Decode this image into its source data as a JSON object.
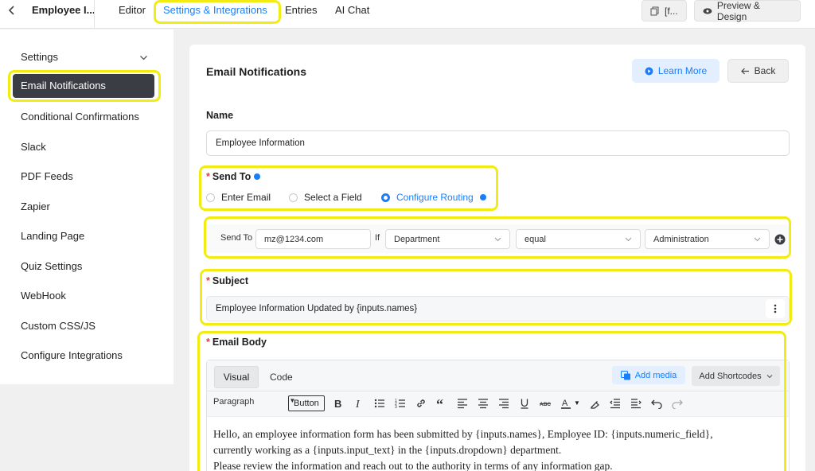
{
  "topbar": {
    "form_name": "Employee I...",
    "tabs": [
      "Editor",
      "Settings & Integrations",
      "Entries",
      "AI Chat"
    ],
    "shortcode_btn": "[f...",
    "preview_btn": "Preview & Design"
  },
  "sidebar": {
    "items": [
      "Settings",
      "Email Notifications",
      "Conditional Confirmations",
      "Slack",
      "PDF Feeds",
      "Zapier",
      "Landing Page",
      "Quiz Settings",
      "WebHook",
      "Custom CSS/JS",
      "Configure Integrations"
    ]
  },
  "card": {
    "title": "Email Notifications",
    "learn_more": "Learn More",
    "back": "Back"
  },
  "form": {
    "name_label": "Name",
    "name_value": "Employee Information",
    "send_to_label": "Send To",
    "send_to_options": [
      "Enter Email",
      "Select a Field",
      "Configure Routing"
    ],
    "selected_option": "Configure Routing",
    "routing": {
      "send_to_label": "Send To",
      "email": "mz@1234.com",
      "if_label": "If",
      "field": "Department",
      "operator": "equal",
      "value": "Administration"
    },
    "subject_label": "Subject",
    "subject_value": "Employee Information Updated by {inputs.names}",
    "email_body_label": "Email Body"
  },
  "editor": {
    "tab_visual": "Visual",
    "tab_code": "Code",
    "add_media": "Add media",
    "add_shortcodes": "Add Shortcodes",
    "format": "Paragraph",
    "button_label": "Button",
    "body_line1": "Hello, an employee information form has been submitted by {inputs.names}, Employee ID: {inputs.numeric_field},",
    "body_line2": "currently working as a {inputs.input_text} in the {inputs.dropdown} department.",
    "body_line3": "Please review the information and reach out to the authority in terms of any information gap."
  },
  "colors": {
    "accent": "#1a7efb",
    "highlight": "#f3ec12",
    "sidebar_active": "#3a3d44"
  }
}
